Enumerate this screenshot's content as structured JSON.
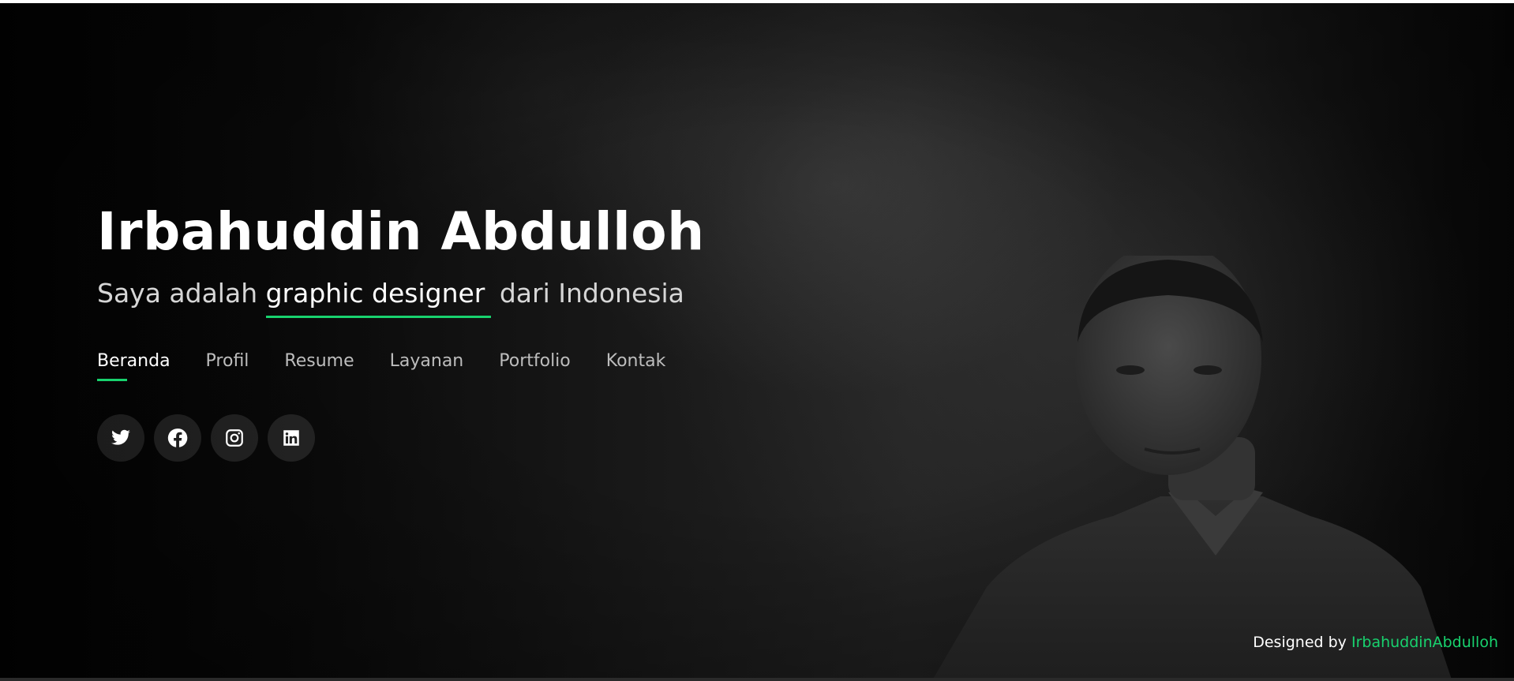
{
  "hero": {
    "name": "Irbahuddin Abdulloh",
    "tagline_prefix": "Saya adalah",
    "tagline_typed": "graphic designer",
    "tagline_suffix": "dari Indonesia"
  },
  "nav": {
    "items": [
      {
        "label": "Beranda",
        "active": true
      },
      {
        "label": "Profil"
      },
      {
        "label": "Resume"
      },
      {
        "label": "Layanan"
      },
      {
        "label": "Portfolio"
      },
      {
        "label": "Kontak"
      }
    ]
  },
  "social": [
    {
      "icon": "twitter-icon"
    },
    {
      "icon": "facebook-icon"
    },
    {
      "icon": "instagram-icon"
    },
    {
      "icon": "linkedin-icon"
    }
  ],
  "credits": {
    "prefix": "Designed by",
    "author": "IrbahuddinAbdulloh"
  },
  "colors": {
    "accent": "#18d26e",
    "text": "#ffffff",
    "background": "#1a1a1a"
  }
}
